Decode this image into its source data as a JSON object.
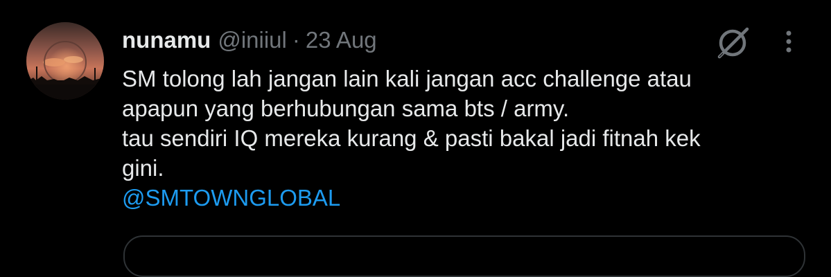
{
  "tweet": {
    "display_name": "nunamu",
    "handle": "@iniiul",
    "separator": "·",
    "date": "23 Aug",
    "lines": [
      "SM tolong lah jangan lain kali jangan acc challenge atau",
      "apapun yang berhubungan sama bts / army.",
      "tau sendiri IQ mereka kurang & pasti bakal jadi fitnah kek",
      "gini."
    ],
    "mention": "@SMTOWNGLOBAL"
  },
  "icons": {
    "avatar": "sunset-profile-photo",
    "grok": "grok-icon",
    "more": "more-options-icon"
  },
  "colors": {
    "background": "#000000",
    "primary_text": "#e7e9ea",
    "secondary_text": "#71767b",
    "link": "#1d9bf0",
    "border": "#2f3336"
  }
}
